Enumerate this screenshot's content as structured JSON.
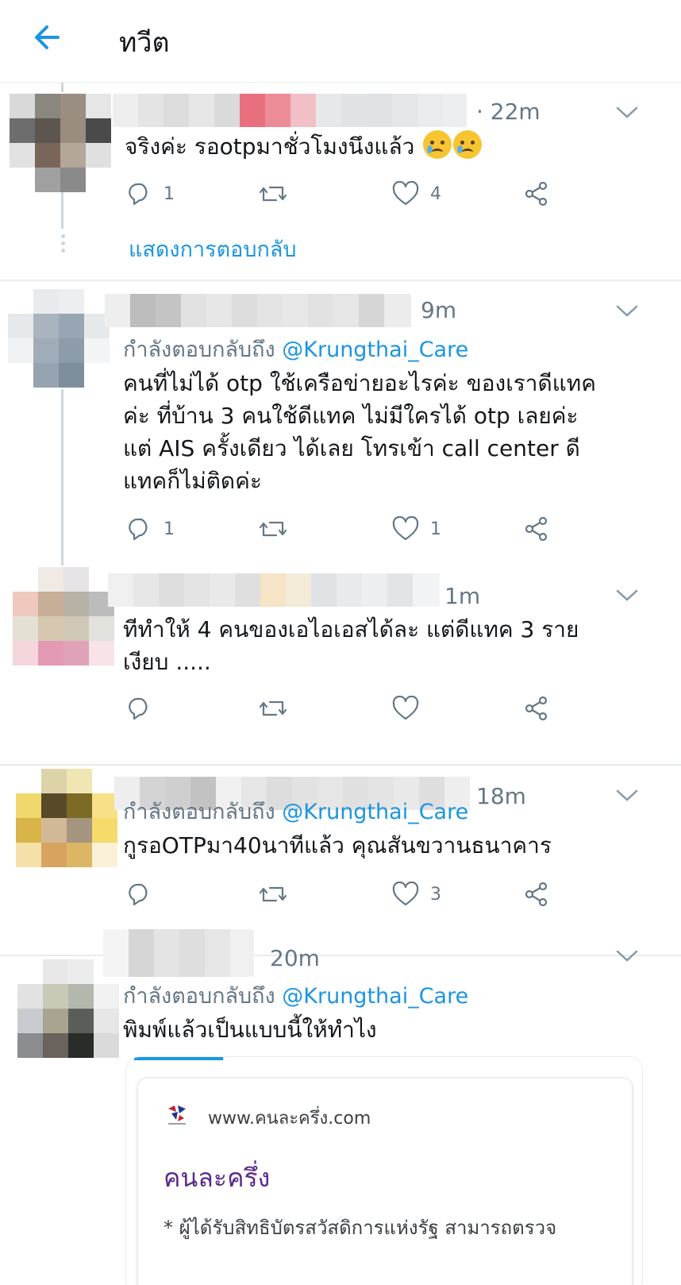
{
  "header": {
    "title": "ทวีต"
  },
  "tweets": [
    {
      "time": "· 22m",
      "reply_prefix": "",
      "reply_handle": "",
      "text": "จริงค่ะ รอotpมาชั่วโมงนึงแล้ว",
      "emoji_name": "crying-face-emoji",
      "reply_count": "1",
      "retweet_count": "",
      "like_count": "4",
      "show_replies": "แสดงการตอบกลับ"
    },
    {
      "time": "9m",
      "reply_prefix": "กำลังตอบกลับถึง ",
      "reply_handle": "@Krungthai_Care",
      "text_lines": [
        "คนที่ไม่ได้ otp ใช้เครือข่ายอะไรค่ะ ของเราดีแทค",
        "ค่ะ ที่บ้าน 3 คนใช้ดีแทค ไม่มีใครได้ otp เลยค่ะ",
        "แต่ AIS ครั้งเดียว ได้เลย โทรเข้า call center  ดี",
        "แทคก็ไม่ติดค่ะ"
      ],
      "reply_count": "1",
      "retweet_count": "",
      "like_count": "1"
    },
    {
      "time": "1m",
      "text_lines": [
        "ทีทำให้ 4 คนของเอไอเอสได้ละ แต่ดีแทค 3 ราย",
        "เงียบ ....."
      ],
      "reply_count": "",
      "retweet_count": "",
      "like_count": ""
    },
    {
      "time": "18m",
      "reply_prefix": "กำลังตอบกลับถึง ",
      "reply_handle": "@Krungthai_Care",
      "text": "กูรอOTPมา40นาทีแล้ว คุณสันขวานธนาคาร",
      "reply_count": "",
      "retweet_count": "",
      "like_count": "3"
    },
    {
      "time": "20m",
      "reply_prefix": "กำลังตอบกลับถึง ",
      "reply_handle": "@Krungthai_Care",
      "text": "พิมพ์แล้วเป็นแบบนี้ให้ทำไง",
      "card": {
        "url": "www.คนละครึ่ง.com",
        "title": "คนละครึ่ง",
        "desc": "* ผู้ได้รับสิทธิบัตรสวัสดิการแห่งรัฐ สามารถตรวจ"
      }
    }
  ],
  "colors": {
    "accent": "#1b95e0",
    "muted": "#657786",
    "divider": "#e6ecf0",
    "card_title": "#5a2a8c"
  },
  "icons": [
    "back-arrow-icon",
    "chevron-down-icon",
    "reply-icon",
    "retweet-icon",
    "like-icon",
    "share-icon"
  ]
}
